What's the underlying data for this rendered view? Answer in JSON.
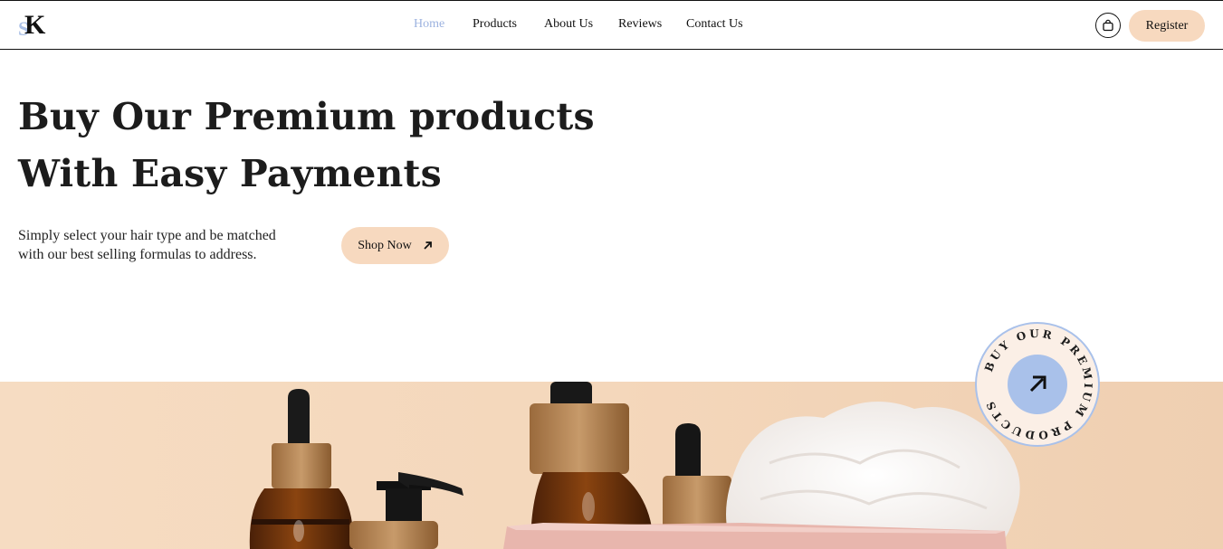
{
  "logo": {
    "letter_s": "S",
    "letter_k": "K"
  },
  "nav": {
    "items": [
      {
        "label": "Home",
        "active": true
      },
      {
        "label": "Products",
        "active": false
      },
      {
        "label": "About Us",
        "active": false
      },
      {
        "label": "Reviews",
        "active": false
      },
      {
        "label": "Contact Us",
        "active": false
      }
    ]
  },
  "header": {
    "cart_icon": "shopping-bag-icon",
    "register_label": "Register"
  },
  "hero": {
    "title_line1": "Buy Our Premium products",
    "title_line2": "With Easy Payments",
    "subtitle_line1": "Simply select your hair type and be matched",
    "subtitle_line2": "with our best selling formulas to address.",
    "shop_now_label": "Shop Now",
    "shop_now_icon": "arrow-up-right-icon"
  },
  "badge": {
    "ring_text": "BUY OUR PREMIUM PRODUCTS",
    "icon": "arrow-up-right-icon"
  },
  "colors": {
    "accent_peach": "#f7d9bf",
    "accent_blue": "#a9c1ea",
    "active_nav": "#9db3e0",
    "photo_background": "#f3d8bd"
  }
}
